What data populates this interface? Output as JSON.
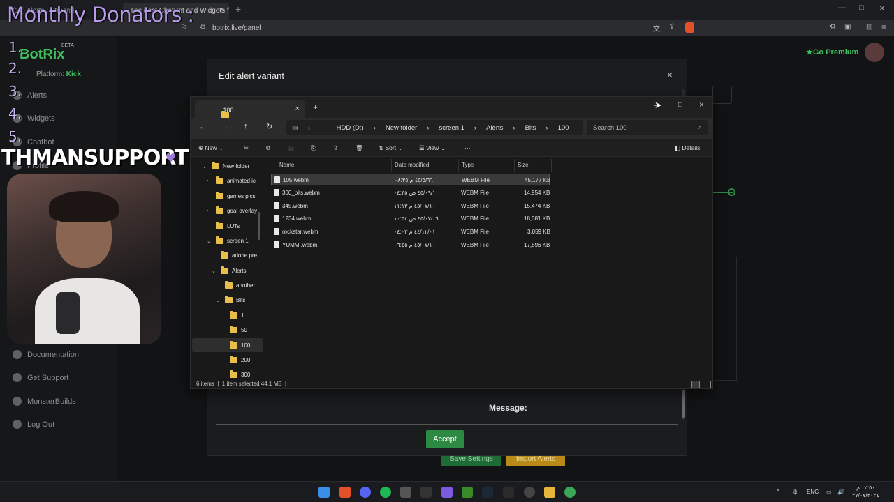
{
  "overlay": {
    "title": "Monthly Donators :",
    "numbers": [
      "1.",
      "2.",
      "3.",
      "4.",
      "5."
    ],
    "support_text": "THMANSUPPORT",
    "heart": "♥"
  },
  "browser": {
    "tab1": "(17) Alerts | Streaml",
    "tab2": "The best ChatBot and Widgets f",
    "url": "botrix.live/panel"
  },
  "app": {
    "logo": "BotRix",
    "beta": "BETA",
    "platform_label": "Platform:",
    "platform_value": "Kick",
    "premium": "Go Premium",
    "sidebar": [
      {
        "label": "Alerts"
      },
      {
        "label": "Widgets"
      },
      {
        "label": "Chatbot"
      },
      {
        "label": "Profile"
      },
      {
        "label": "Documentation"
      },
      {
        "label": "Get Support"
      },
      {
        "label": "MonsterBuilds"
      },
      {
        "label": "Log Out"
      }
    ],
    "bottom_buttons": [
      "Save Settings",
      "Import Alerts"
    ]
  },
  "dialog": {
    "title": "Edit alert variant",
    "close": "×",
    "message_label": "Message:",
    "accept": "Accept"
  },
  "explorer": {
    "tab_title": "100",
    "breadcrumb": [
      "HDD (D:)",
      "New folder",
      "screen 1",
      "Alerts",
      "Bits",
      "100"
    ],
    "search_placeholder": "Search 100",
    "commands": {
      "new": "New",
      "sort": "Sort",
      "view": "View",
      "details": "Details"
    },
    "columns": {
      "name": "Name",
      "date": "Date modified",
      "type": "Type",
      "size": "Size"
    },
    "files": [
      {
        "name": "105.webm",
        "date": "٤٥/٥/٦٦ م ٠٨:٣٥",
        "type": "WEBM File",
        "size": "45,177 KB"
      },
      {
        "name": "300_bits.webm",
        "date": "٤٥/٠٩/١٠ ص ٠٤:٣٥",
        "type": "WEBM File",
        "size": "14,954 KB"
      },
      {
        "name": "345.webm",
        "date": "٤٥/٠٧/١٠ م ١١:١٣",
        "type": "WEBM File",
        "size": "15,474 KB"
      },
      {
        "name": "1234.webm",
        "date": "٤٥/٠٧/٠٦ ص ١٠:٥٤",
        "type": "WEBM File",
        "size": "18,381 KB"
      },
      {
        "name": "rockstar.webm",
        "date": "٤٤/١٢/٠١ م ٠٤:٠٣",
        "type": "WEBM File",
        "size": "3,059 KB"
      },
      {
        "name": "YUMMI.webm",
        "date": "٤٥/٠٧/١٠ م ٠٦:٤٥",
        "type": "WEBM File",
        "size": "17,896 KB"
      }
    ],
    "tree": [
      {
        "label": "New folder",
        "caret": "⌄"
      },
      {
        "label": "animated ic",
        "caret": "›"
      },
      {
        "label": "games pics",
        "caret": ""
      },
      {
        "label": "goal overlay",
        "caret": "›"
      },
      {
        "label": "LUTs",
        "caret": ""
      },
      {
        "label": "screen 1",
        "caret": "⌄"
      },
      {
        "label": "adobe pre",
        "caret": ""
      },
      {
        "label": "Alerts",
        "caret": "⌄"
      },
      {
        "label": "another",
        "caret": ""
      },
      {
        "label": "Bits",
        "caret": "⌄"
      },
      {
        "label": "1",
        "caret": ""
      },
      {
        "label": "50",
        "caret": ""
      },
      {
        "label": "100",
        "caret": ""
      },
      {
        "label": "200",
        "caret": ""
      },
      {
        "label": "300",
        "caret": ""
      }
    ],
    "status_items": "6 items",
    "status_selected": "1 item selected  44.1 MB"
  },
  "taskbar": {
    "lang": "ENG",
    "time": "٠٢:٥٠ م",
    "date": "٢٧/٠٧/٢٠٢٤"
  }
}
